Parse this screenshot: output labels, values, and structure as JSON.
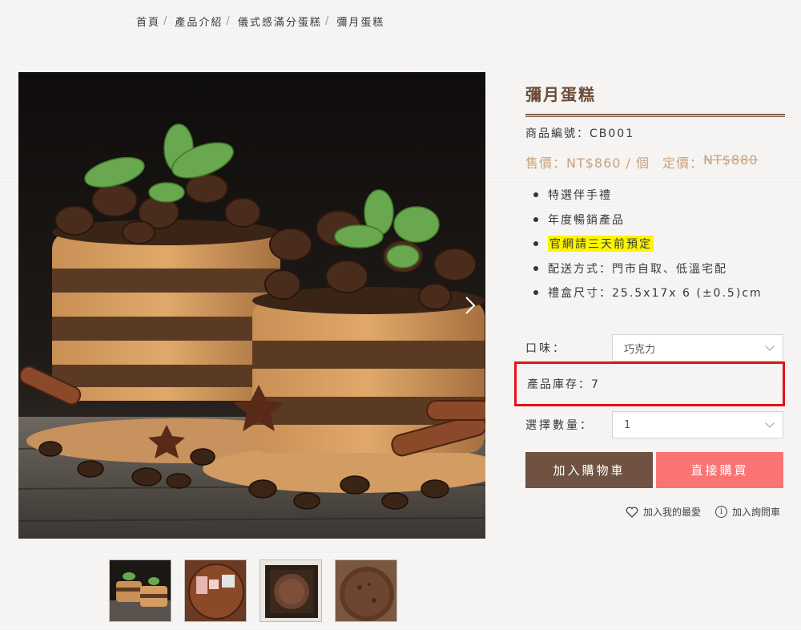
{
  "breadcrumb": {
    "home": "首頁",
    "products": "產品介紹",
    "category": "儀式感滿分蛋糕",
    "current": "彌月蛋糕"
  },
  "product": {
    "title": "彌月蛋糕",
    "sku": "商品編號：CB001",
    "price": "售價：NT$860",
    "unit": "/ 個",
    "list_label": "定價：",
    "list_value": "NT$880",
    "features": [
      "特選伴手禮",
      "年度暢銷產品",
      "官網請三天前預定",
      "配送方式：門市自取、低溫宅配",
      "禮盒尺寸：25.5x17x 6 (±0.5)cm"
    ]
  },
  "options": {
    "flavor_label": "口味：",
    "flavor_value": "巧克力",
    "stock_text": "產品庫存：7",
    "qty_label": "選擇數量：",
    "qty_value": "1"
  },
  "actions": {
    "add_to_cart": "加入購物車",
    "buy_now": "直接購買",
    "add_favorite": "加入我的最愛",
    "add_inquiry": "加入詢問車"
  },
  "colors": {
    "title": "#6b4b38",
    "price": "#c9a27d",
    "cart_button": "#6f5242",
    "buy_button": "#fa7474",
    "highlight": "#fdf500",
    "stock_border": "#e3131b"
  },
  "icons": {
    "next": "chevron-right-icon",
    "favorite": "heart-icon",
    "inquiry": "info-icon"
  }
}
